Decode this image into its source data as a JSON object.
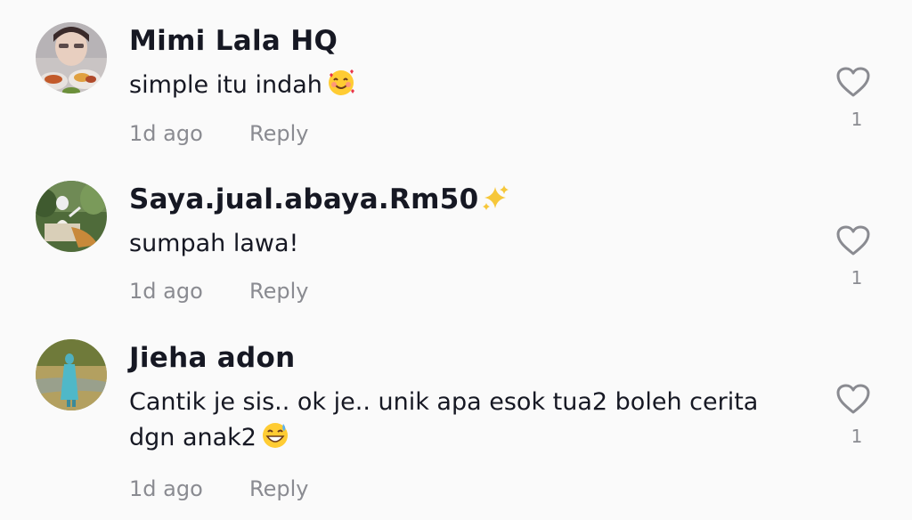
{
  "comments": [
    {
      "username": "Mimi Lala HQ",
      "text": "simple itu indah",
      "text_emoji": "smiling-face-with-hearts",
      "time": "1d ago",
      "reply_label": "Reply",
      "likes": "1"
    },
    {
      "username": "Saya.jual.abaya.Rm50",
      "username_emoji": "sparkles",
      "text": "sumpah lawa!",
      "time": "1d ago",
      "reply_label": "Reply",
      "likes": "1"
    },
    {
      "username": "Jieha adon",
      "text": "Cantik je sis.. ok je.. unik apa esok tua2 boleh cerita dgn anak2",
      "text_emoji": "grinning-face-with-sweat",
      "time": "1d ago",
      "reply_label": "Reply",
      "likes": "1"
    }
  ],
  "colors": {
    "background": "#fafafa",
    "primary_text": "#161823",
    "secondary_text": "#8a8b91",
    "icon": "#8a8b91"
  }
}
